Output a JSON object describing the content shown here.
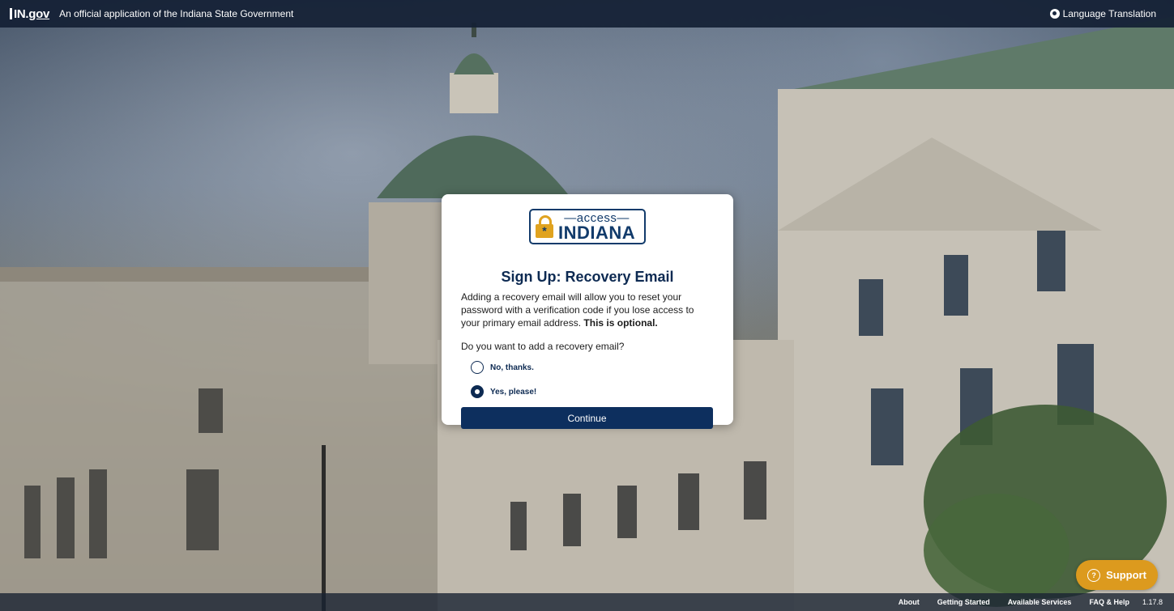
{
  "topbar": {
    "logo_text": "IN.gov",
    "logo_prefix": "IN.",
    "logo_suffix": "gov",
    "official_text": "An official application of the Indiana State Government",
    "language_label": "Language Translation",
    "language_icon": "globe-icon"
  },
  "logo": {
    "top": "access",
    "bottom": "INDIANA",
    "lock_icon": "lock-icon",
    "brand_color": "#123b6b",
    "accent_color": "#e0a320"
  },
  "card": {
    "title": "Sign Up: Recovery Email",
    "description": "Adding a recovery email will allow you to reset your password with a verification code if you lose access to your primary email address.",
    "description_bold": "This is optional.",
    "question": "Do you want to add a recovery email?",
    "options": [
      {
        "label": "No, thanks.",
        "selected": false
      },
      {
        "label": "Yes, please!",
        "selected": true
      }
    ],
    "continue_label": "Continue"
  },
  "footer": {
    "links": [
      "About",
      "Getting Started",
      "Available Services",
      "FAQ & Help"
    ],
    "version": "1.17.8"
  },
  "support": {
    "label": "Support",
    "icon": "help-icon",
    "color": "#dc9a1e"
  }
}
